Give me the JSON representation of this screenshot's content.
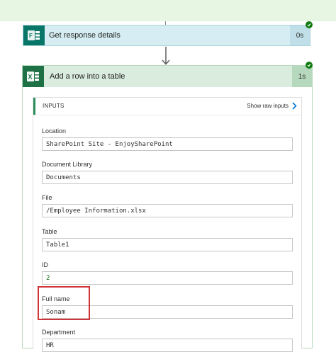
{
  "flow": {
    "previous_step": {
      "title": "Get response details",
      "duration": "0s",
      "icon": "forms-icon",
      "status_icon": "success-check-icon"
    },
    "current_step": {
      "title": "Add a row into a table",
      "duration": "1s",
      "icon": "excel-icon",
      "status_icon": "success-check-icon"
    }
  },
  "inputs": {
    "heading": "INPUTS",
    "show_raw_label": "Show raw inputs",
    "fields": [
      {
        "label": "Location",
        "value": "SharePoint Site - EnjoySharePoint"
      },
      {
        "label": "Document Library",
        "value": "Documents"
      },
      {
        "label": "File",
        "value": "/Employee Information.xlsx"
      },
      {
        "label": "Table",
        "value": "Table1"
      },
      {
        "label": "ID",
        "value": "2"
      },
      {
        "label": "Full name",
        "value": "Sonam"
      },
      {
        "label": "Department",
        "value": "HR"
      }
    ]
  },
  "colors": {
    "forms_brand": "#077568",
    "excel_brand": "#1e7145",
    "success": "#107c10",
    "highlight": "#d13438"
  }
}
